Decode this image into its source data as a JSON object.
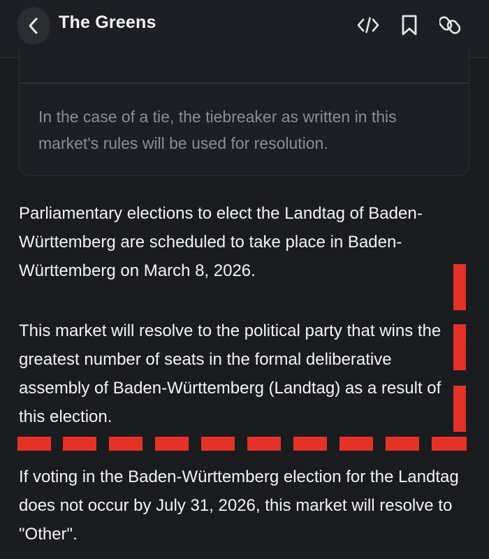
{
  "header": {
    "title": "The Greens",
    "icons": {
      "back": "chevron-left-icon",
      "embed": "code-icon",
      "bookmark": "bookmark-icon",
      "link": "link-icon"
    }
  },
  "rules_card": {
    "text": "In the case of a tie, the tiebreaker as written in this market's rules will be used for resolution."
  },
  "description": {
    "paragraph_1": "Parliamentary elections to elect the Landtag of Baden-Württemberg are scheduled to take place in Baden-Württemberg on March 8, 2026.",
    "paragraph_2": "This market will resolve to the political party that wins the greatest number of seats in the formal deliberative assembly of Baden-Württemberg (Landtag) as a result of this election.",
    "paragraph_3": "If voting in the Baden-Württemberg election for the Landtag does not occur by July 31, 2026, this market will resolve to \"Other\"."
  },
  "colors": {
    "background": "#1b1c20",
    "annotation_red": "#e53228",
    "muted_text": "#8b8e96"
  }
}
